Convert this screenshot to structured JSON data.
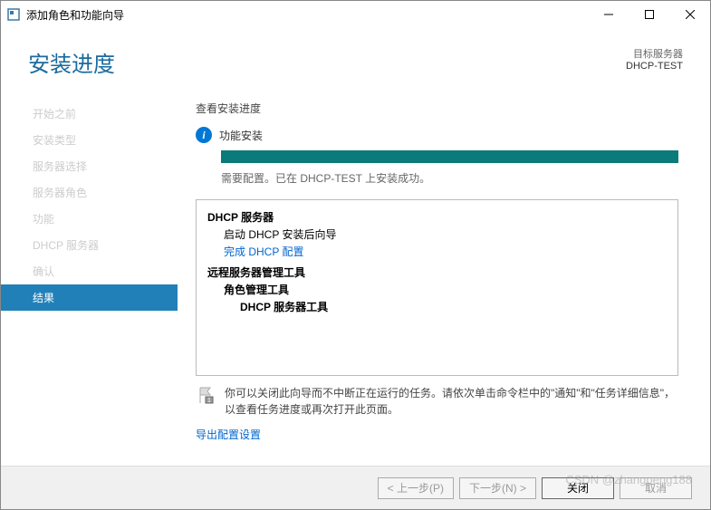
{
  "window": {
    "title": "添加角色和功能向导"
  },
  "header": {
    "page_title": "安装进度",
    "target_label": "目标服务器",
    "target_server": "DHCP-TEST"
  },
  "sidebar": {
    "items": [
      {
        "label": "开始之前"
      },
      {
        "label": "安装类型"
      },
      {
        "label": "服务器选择"
      },
      {
        "label": "服务器角色"
      },
      {
        "label": "功能"
      },
      {
        "label": "DHCP 服务器"
      },
      {
        "label": "确认"
      },
      {
        "label": "结果"
      }
    ]
  },
  "content": {
    "section_label": "查看安装进度",
    "info_text": "功能安装",
    "status_text": "需要配置。已在 DHCP-TEST 上安装成功。",
    "tree": {
      "dhcp_server": "DHCP 服务器",
      "dhcp_wizard": "启动 DHCP 安装后向导",
      "dhcp_config_link": "完成 DHCP 配置",
      "remote_tools": "远程服务器管理工具",
      "role_tools": "角色管理工具",
      "dhcp_tools": "DHCP 服务器工具"
    },
    "note_text": "你可以关闭此向导而不中断正在运行的任务。请依次单击命令栏中的\"通知\"和\"任务详细信息\"，以查看任务进度或再次打开此页面。",
    "export_link": "导出配置设置"
  },
  "footer": {
    "prev": "< 上一步(P)",
    "next": "下一步(N) >",
    "close": "关闭",
    "cancel": "取消"
  },
  "watermark": "CSDN @zhangpeng188"
}
